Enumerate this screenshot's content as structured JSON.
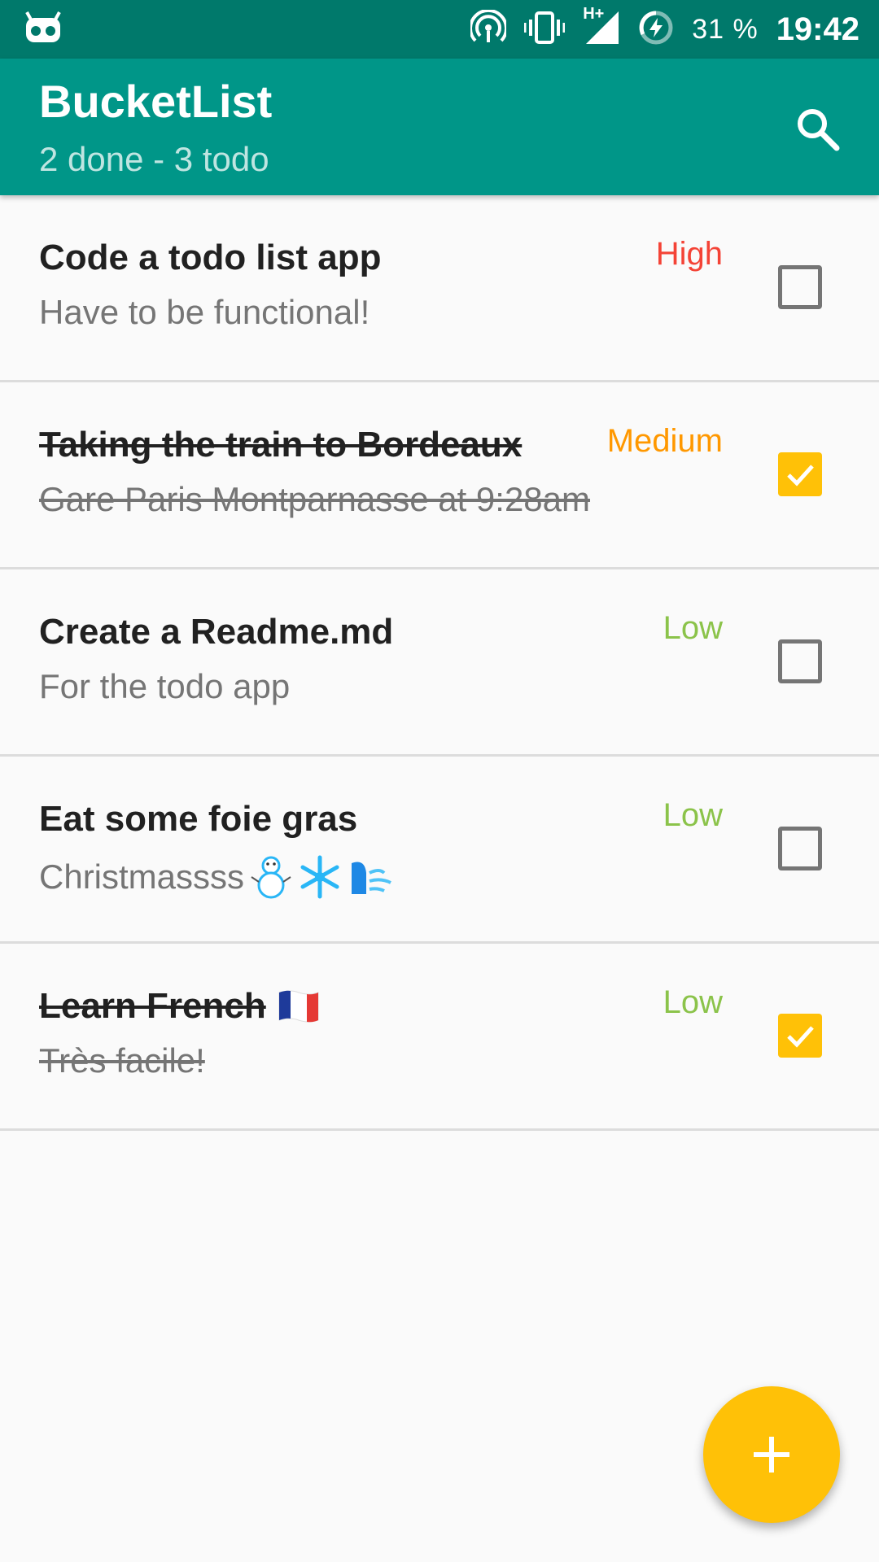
{
  "status_bar": {
    "battery_percent": "31 %",
    "time": "19:42",
    "network_label": "H+",
    "icons": [
      "android-logo-icon",
      "hotspot-icon",
      "vibrate-icon",
      "signal-icon",
      "battery-charging-icon"
    ]
  },
  "app_bar": {
    "title": "BucketList",
    "subtitle": "2 done - 3 todo",
    "search_icon": "search-icon"
  },
  "colors": {
    "status_bar": "#00796b",
    "app_bar": "#009688",
    "accent": "#ffc107",
    "priority_high": "#f44336",
    "priority_medium": "#ff9800",
    "priority_low": "#8bc34a"
  },
  "tasks": [
    {
      "title": "Code a todo list app",
      "description": "Have to be functional!",
      "priority": "High",
      "done": false
    },
    {
      "title": "Taking the train to Bordeaux",
      "description": "Gare Paris Montparnasse at 9:28am",
      "priority": "Medium",
      "done": true
    },
    {
      "title": "Create a Readme.md",
      "description": "For the todo app",
      "priority": "Low",
      "done": false
    },
    {
      "title": "Eat some foie gras",
      "description": "Christmassss",
      "description_emoji": [
        "snowman-icon",
        "snowflake-icon",
        "wind-face-icon"
      ],
      "priority": "Low",
      "done": false
    },
    {
      "title": "Learn French",
      "title_emoji": [
        "france-flag-icon"
      ],
      "description": "Très facile!",
      "priority": "Low",
      "done": true
    }
  ],
  "fab": {
    "icon": "plus-icon"
  }
}
